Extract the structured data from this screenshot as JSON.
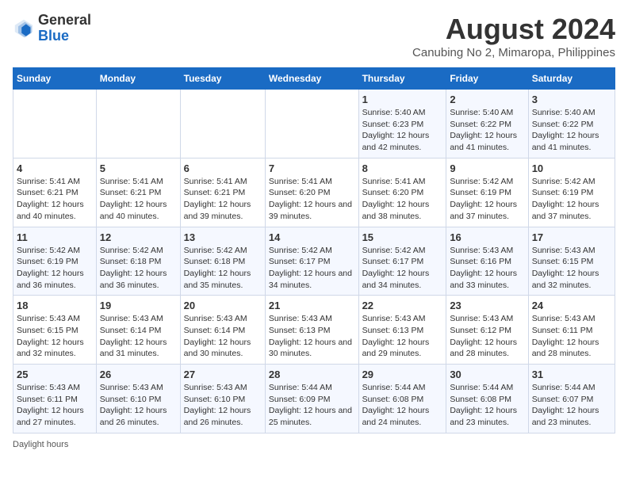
{
  "header": {
    "logo": {
      "general": "General",
      "blue": "Blue"
    },
    "title": "August 2024",
    "subtitle": "Canubing No 2, Mimaropa, Philippines"
  },
  "days": [
    "Sunday",
    "Monday",
    "Tuesday",
    "Wednesday",
    "Thursday",
    "Friday",
    "Saturday"
  ],
  "weeks": [
    [
      {
        "date": "",
        "sunrise": "",
        "sunset": "",
        "daylight": ""
      },
      {
        "date": "",
        "sunrise": "",
        "sunset": "",
        "daylight": ""
      },
      {
        "date": "",
        "sunrise": "",
        "sunset": "",
        "daylight": ""
      },
      {
        "date": "",
        "sunrise": "",
        "sunset": "",
        "daylight": ""
      },
      {
        "date": "1",
        "sunrise": "Sunrise: 5:40 AM",
        "sunset": "Sunset: 6:23 PM",
        "daylight": "Daylight: 12 hours and 42 minutes."
      },
      {
        "date": "2",
        "sunrise": "Sunrise: 5:40 AM",
        "sunset": "Sunset: 6:22 PM",
        "daylight": "Daylight: 12 hours and 41 minutes."
      },
      {
        "date": "3",
        "sunrise": "Sunrise: 5:40 AM",
        "sunset": "Sunset: 6:22 PM",
        "daylight": "Daylight: 12 hours and 41 minutes."
      }
    ],
    [
      {
        "date": "4",
        "sunrise": "Sunrise: 5:41 AM",
        "sunset": "Sunset: 6:21 PM",
        "daylight": "Daylight: 12 hours and 40 minutes."
      },
      {
        "date": "5",
        "sunrise": "Sunrise: 5:41 AM",
        "sunset": "Sunset: 6:21 PM",
        "daylight": "Daylight: 12 hours and 40 minutes."
      },
      {
        "date": "6",
        "sunrise": "Sunrise: 5:41 AM",
        "sunset": "Sunset: 6:21 PM",
        "daylight": "Daylight: 12 hours and 39 minutes."
      },
      {
        "date": "7",
        "sunrise": "Sunrise: 5:41 AM",
        "sunset": "Sunset: 6:20 PM",
        "daylight": "Daylight: 12 hours and 39 minutes."
      },
      {
        "date": "8",
        "sunrise": "Sunrise: 5:41 AM",
        "sunset": "Sunset: 6:20 PM",
        "daylight": "Daylight: 12 hours and 38 minutes."
      },
      {
        "date": "9",
        "sunrise": "Sunrise: 5:42 AM",
        "sunset": "Sunset: 6:19 PM",
        "daylight": "Daylight: 12 hours and 37 minutes."
      },
      {
        "date": "10",
        "sunrise": "Sunrise: 5:42 AM",
        "sunset": "Sunset: 6:19 PM",
        "daylight": "Daylight: 12 hours and 37 minutes."
      }
    ],
    [
      {
        "date": "11",
        "sunrise": "Sunrise: 5:42 AM",
        "sunset": "Sunset: 6:19 PM",
        "daylight": "Daylight: 12 hours and 36 minutes."
      },
      {
        "date": "12",
        "sunrise": "Sunrise: 5:42 AM",
        "sunset": "Sunset: 6:18 PM",
        "daylight": "Daylight: 12 hours and 36 minutes."
      },
      {
        "date": "13",
        "sunrise": "Sunrise: 5:42 AM",
        "sunset": "Sunset: 6:18 PM",
        "daylight": "Daylight: 12 hours and 35 minutes."
      },
      {
        "date": "14",
        "sunrise": "Sunrise: 5:42 AM",
        "sunset": "Sunset: 6:17 PM",
        "daylight": "Daylight: 12 hours and 34 minutes."
      },
      {
        "date": "15",
        "sunrise": "Sunrise: 5:42 AM",
        "sunset": "Sunset: 6:17 PM",
        "daylight": "Daylight: 12 hours and 34 minutes."
      },
      {
        "date": "16",
        "sunrise": "Sunrise: 5:43 AM",
        "sunset": "Sunset: 6:16 PM",
        "daylight": "Daylight: 12 hours and 33 minutes."
      },
      {
        "date": "17",
        "sunrise": "Sunrise: 5:43 AM",
        "sunset": "Sunset: 6:15 PM",
        "daylight": "Daylight: 12 hours and 32 minutes."
      }
    ],
    [
      {
        "date": "18",
        "sunrise": "Sunrise: 5:43 AM",
        "sunset": "Sunset: 6:15 PM",
        "daylight": "Daylight: 12 hours and 32 minutes."
      },
      {
        "date": "19",
        "sunrise": "Sunrise: 5:43 AM",
        "sunset": "Sunset: 6:14 PM",
        "daylight": "Daylight: 12 hours and 31 minutes."
      },
      {
        "date": "20",
        "sunrise": "Sunrise: 5:43 AM",
        "sunset": "Sunset: 6:14 PM",
        "daylight": "Daylight: 12 hours and 30 minutes."
      },
      {
        "date": "21",
        "sunrise": "Sunrise: 5:43 AM",
        "sunset": "Sunset: 6:13 PM",
        "daylight": "Daylight: 12 hours and 30 minutes."
      },
      {
        "date": "22",
        "sunrise": "Sunrise: 5:43 AM",
        "sunset": "Sunset: 6:13 PM",
        "daylight": "Daylight: 12 hours and 29 minutes."
      },
      {
        "date": "23",
        "sunrise": "Sunrise: 5:43 AM",
        "sunset": "Sunset: 6:12 PM",
        "daylight": "Daylight: 12 hours and 28 minutes."
      },
      {
        "date": "24",
        "sunrise": "Sunrise: 5:43 AM",
        "sunset": "Sunset: 6:11 PM",
        "daylight": "Daylight: 12 hours and 28 minutes."
      }
    ],
    [
      {
        "date": "25",
        "sunrise": "Sunrise: 5:43 AM",
        "sunset": "Sunset: 6:11 PM",
        "daylight": "Daylight: 12 hours and 27 minutes."
      },
      {
        "date": "26",
        "sunrise": "Sunrise: 5:43 AM",
        "sunset": "Sunset: 6:10 PM",
        "daylight": "Daylight: 12 hours and 26 minutes."
      },
      {
        "date": "27",
        "sunrise": "Sunrise: 5:43 AM",
        "sunset": "Sunset: 6:10 PM",
        "daylight": "Daylight: 12 hours and 26 minutes."
      },
      {
        "date": "28",
        "sunrise": "Sunrise: 5:44 AM",
        "sunset": "Sunset: 6:09 PM",
        "daylight": "Daylight: 12 hours and 25 minutes."
      },
      {
        "date": "29",
        "sunrise": "Sunrise: 5:44 AM",
        "sunset": "Sunset: 6:08 PM",
        "daylight": "Daylight: 12 hours and 24 minutes."
      },
      {
        "date": "30",
        "sunrise": "Sunrise: 5:44 AM",
        "sunset": "Sunset: 6:08 PM",
        "daylight": "Daylight: 12 hours and 23 minutes."
      },
      {
        "date": "31",
        "sunrise": "Sunrise: 5:44 AM",
        "sunset": "Sunset: 6:07 PM",
        "daylight": "Daylight: 12 hours and 23 minutes."
      }
    ]
  ],
  "footer": {
    "daylight_hours_label": "Daylight hours"
  }
}
